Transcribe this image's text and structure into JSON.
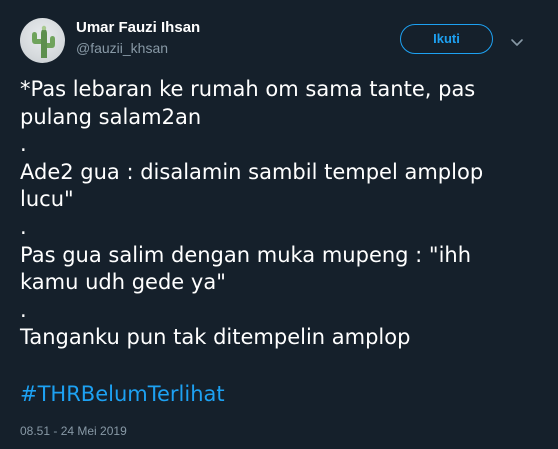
{
  "user": {
    "name": "Umar Fauzi Ihsan",
    "handle": "@fauzii_khsan"
  },
  "follow_button": {
    "label": "Ikuti"
  },
  "tweet": {
    "lines": [
      "*Pas lebaran ke rumah om sama tante, pas",
      "pulang salam2an",
      ".",
      "Ade2 gua : disalamin sambil tempel amplop",
      "lucu\"",
      ".",
      "Pas gua salim dengan muka mupeng : \"ihh",
      "kamu udh gede ya\"",
      ".",
      "Tanganku pun tak ditempelin amplop"
    ],
    "hashtag": "#THRBelumTerlihat",
    "timestamp": "08.51 - 24 Mei 2019"
  },
  "colors": {
    "background": "#15202b",
    "accent": "#1da1f2",
    "secondary_text": "#8899a6"
  }
}
